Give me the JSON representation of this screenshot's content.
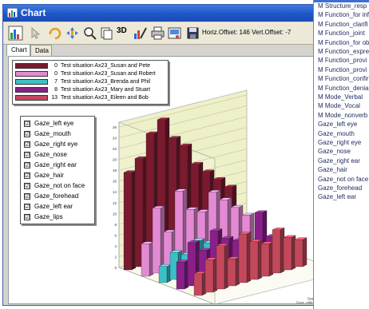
{
  "window": {
    "title": "Chart"
  },
  "toolbar": {
    "status_text": "Horiz.Offset: 146 Vert.Offset: -7",
    "threed_label": "3D"
  },
  "tabs": [
    {
      "label": "Chart",
      "active": true
    },
    {
      "label": "Data",
      "active": false
    }
  ],
  "series_legend": [
    {
      "count": "0",
      "label": "Test situation Ax23_Susan and Pete",
      "color": "#7a1a2e"
    },
    {
      "count": "0",
      "label": "Test situation Ax23_Susan and Robert",
      "color": "#e48ad4"
    },
    {
      "count": "7",
      "label": "Test situation Ax23_Brenda and Phil",
      "color": "#3cc0c8"
    },
    {
      "count": "8",
      "label": "Test situation Ax23_Mary and Stuart",
      "color": "#8a1f8a"
    },
    {
      "count": "13",
      "label": "Test situation Ax23_Eileen and Bob",
      "color": "#c4485c"
    }
  ],
  "category_legend": [
    {
      "label": "Gaze_left eye",
      "checked": true
    },
    {
      "label": "Gaze_mouth",
      "checked": true
    },
    {
      "label": "Gaze_right eye",
      "checked": true
    },
    {
      "label": "Gaze_nose",
      "checked": true
    },
    {
      "label": "Gaze_right ear",
      "checked": true
    },
    {
      "label": "Gaze_hair",
      "checked": true
    },
    {
      "label": "Gaze_not on face",
      "checked": true
    },
    {
      "label": "Gaze_forehead",
      "checked": true
    },
    {
      "label": "Gaze_left ear",
      "checked": true
    },
    {
      "label": "Gaze_lips",
      "checked": true
    }
  ],
  "checkmark": "☑",
  "popup_list": [
    "M Structure_resp",
    "M Function_for inf",
    "M Function_clarifi",
    "M Function_joint",
    "M Function_for ob",
    "M Function_expre",
    "M Function_provi",
    "M Function_provi",
    "M Function_confir",
    "M Function_denial",
    "M Mode_Verbal",
    "M Mode_Vocal",
    "M Mode_nonverb",
    "Gaze_left eye",
    "Gaze_mouth",
    "Gaze_right eye",
    "Gaze_nose",
    "Gaze_right ear",
    "Gaze_hair",
    "Gaze_not on face",
    "Gaze_forehead",
    "Gaze_left ear"
  ],
  "chart_data": {
    "type": "bar",
    "ylim": [
      0,
      26
    ],
    "y_ticks": [
      "0",
      "2",
      "4",
      "6",
      "8",
      "10",
      "12",
      "14",
      "16",
      "18",
      "20",
      "22",
      "24",
      "26"
    ],
    "categories": [
      "Gaze_left eye",
      "Gaze_mouth",
      "Gaze_right eye",
      "Gaze_nose",
      "Gaze_right ear",
      "Gaze_hair",
      "Gaze_not on face",
      "Gaze_forehead",
      "Gaze_left ear",
      "Gaze_lips"
    ],
    "series": [
      {
        "color": "#7a1a2e",
        "values": [
          18,
          20,
          24,
          26,
          22,
          20,
          16,
          14,
          12,
          10
        ]
      },
      {
        "color": "#e48ad4",
        "values": [
          6,
          12,
          7,
          14,
          10,
          9,
          12,
          10,
          8,
          6
        ]
      },
      {
        "color": "#3cc0c8",
        "values": [
          3,
          5,
          4,
          6,
          5,
          3,
          4,
          3,
          2,
          2
        ]
      },
      {
        "color": "#8a1f8a",
        "values": [
          5,
          8,
          6,
          9,
          7,
          6,
          5,
          10,
          5,
          4
        ]
      },
      {
        "color": "#c4485c",
        "values": [
          4,
          6,
          8,
          5,
          9,
          7,
          6,
          8,
          6,
          5
        ]
      }
    ]
  }
}
